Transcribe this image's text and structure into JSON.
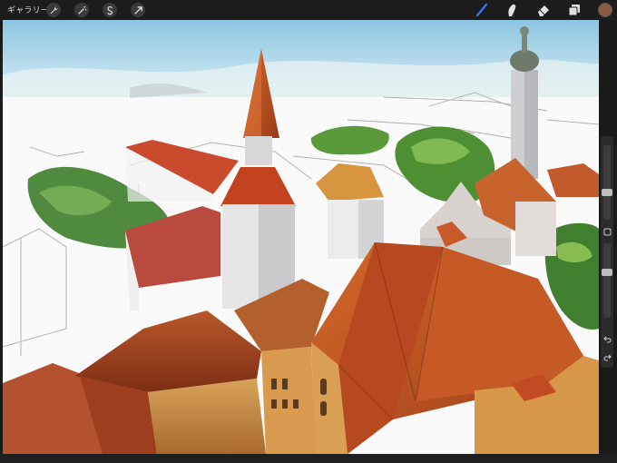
{
  "toolbar": {
    "gallery_label": "ギャラリー",
    "left_tools": [
      "wrench-icon",
      "magic-wand-icon",
      "selection-icon",
      "transform-arrow-icon"
    ],
    "right_tools": [
      "brush-icon",
      "smudge-icon",
      "eraser-icon",
      "layers-icon"
    ],
    "active_tool": "brush-icon",
    "accent": "#2f7df6",
    "current_color": "#8a5a44"
  },
  "sidebar": {
    "brush_size_level": 0.35,
    "opacity_level": 0.62,
    "buttons": [
      "modify-square-icon",
      "undo-icon",
      "redo-icon"
    ]
  },
  "canvas": {
    "subject": "painting-old-town-rooftops"
  }
}
